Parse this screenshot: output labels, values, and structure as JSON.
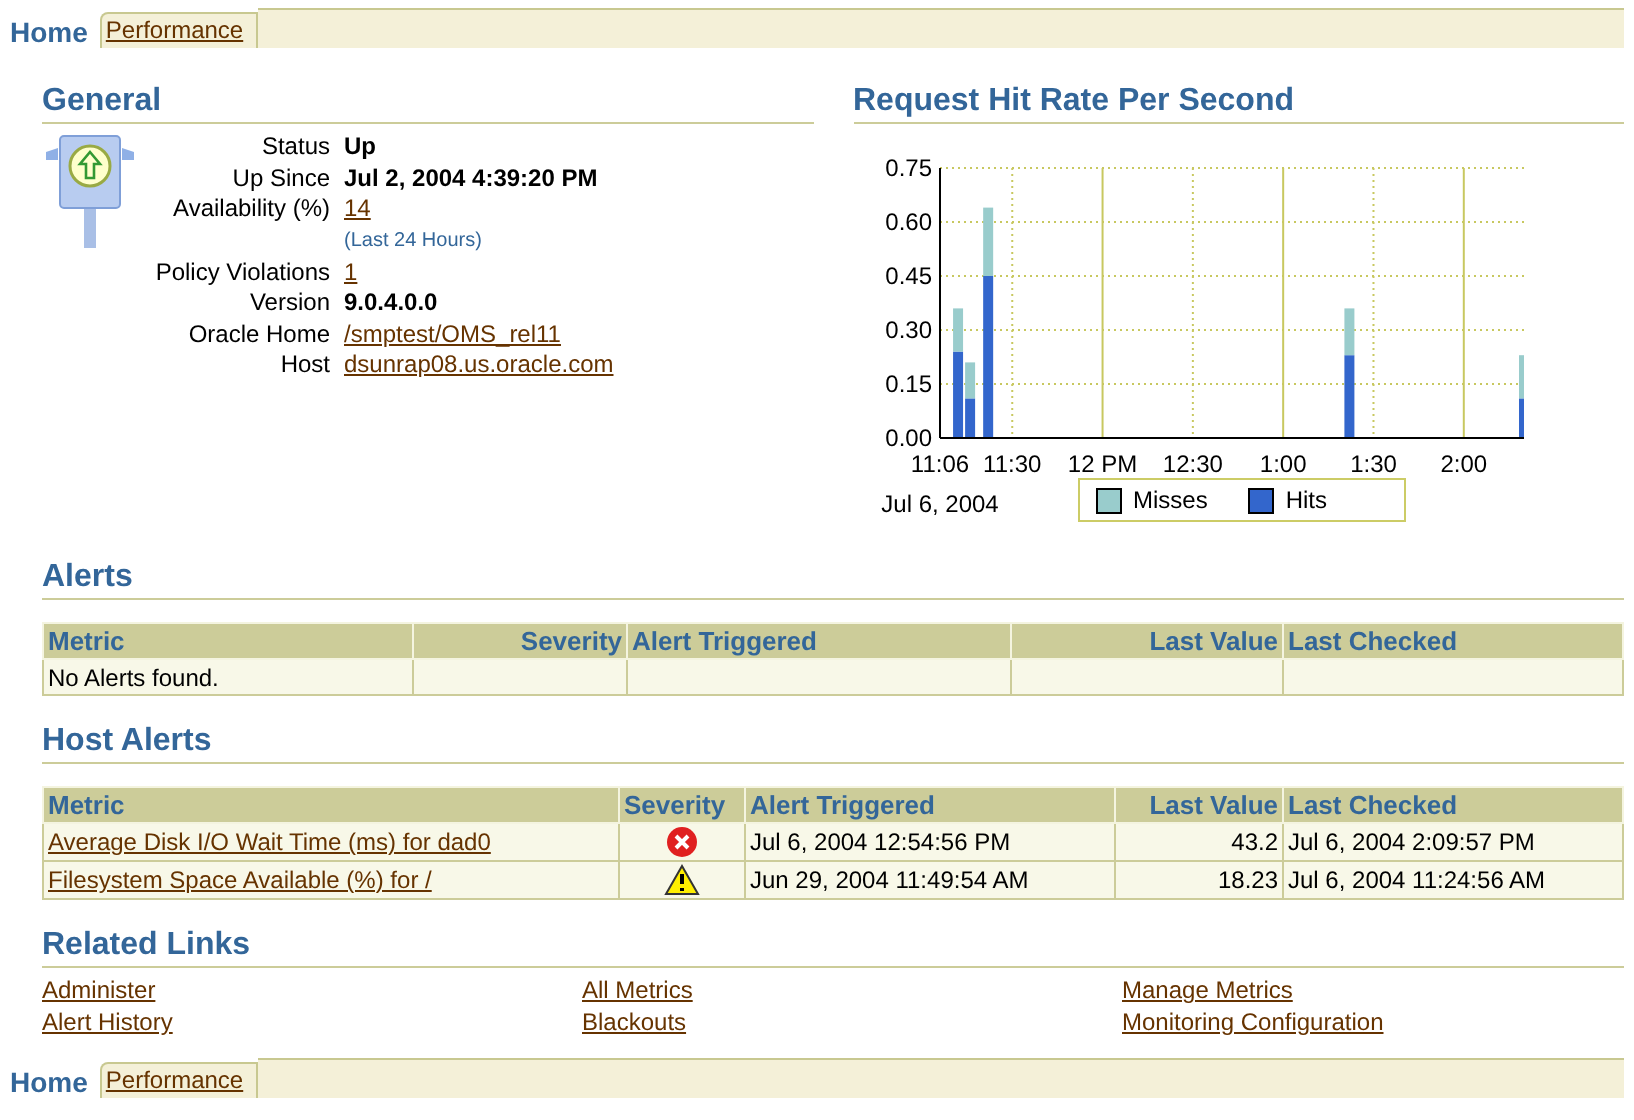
{
  "tabs": [
    {
      "label": "Home",
      "selected": true
    },
    {
      "label": "Performance",
      "selected": false
    }
  ],
  "general": {
    "title": "General",
    "properties": [
      {
        "label": "Status",
        "value": "Up",
        "kind": "text"
      },
      {
        "label": "Up Since",
        "value": "Jul 2, 2004 4:39:20 PM",
        "kind": "text"
      },
      {
        "label": "Availability (%)",
        "value": "14",
        "kind": "link",
        "note": "(Last 24 Hours)"
      },
      {
        "label": "Policy Violations",
        "value": "1",
        "kind": "link"
      },
      {
        "label": "Version",
        "value": "9.0.4.0.0",
        "kind": "text"
      },
      {
        "label": "Oracle Home",
        "value": "/smptest/OMS_rel11",
        "kind": "link"
      },
      {
        "label": "Host",
        "value": "dsunrap08.us.oracle.com",
        "kind": "link"
      }
    ]
  },
  "hit_rate": {
    "title": "Request Hit Rate Per Second",
    "date_label": "Jul 6, 2004",
    "chart_data": {
      "type": "bar",
      "stacked": true,
      "categories": [
        "11:06",
        null,
        null,
        null,
        null,
        null,
        null,
        null,
        null,
        null,
        null,
        null,
        "11:30",
        null,
        null,
        null,
        null,
        null,
        null,
        null,
        null,
        null,
        null,
        null,
        null,
        null,
        null,
        "12 PM",
        null,
        null,
        null,
        null,
        null,
        null,
        null,
        null,
        null,
        null,
        null,
        null,
        null,
        null,
        "12:30",
        null,
        null,
        null,
        null,
        null,
        null,
        null,
        null,
        null,
        null,
        null,
        null,
        null,
        null,
        "1:00",
        null,
        null,
        null,
        null,
        null,
        null,
        null,
        null,
        null,
        null,
        null,
        null,
        null,
        null,
        "1:30",
        null,
        null,
        null,
        null,
        null,
        null,
        null,
        null,
        null,
        null,
        null,
        null,
        null,
        null,
        "2:00",
        null,
        null,
        null,
        null,
        null,
        null,
        null,
        null,
        null,
        null
      ],
      "series": [
        {
          "name": "Misses",
          "color": "#99cccc",
          "values": [
            null,
            null,
            null,
            0.12,
            null,
            0.1,
            null,
            null,
            0.19,
            null,
            null,
            null,
            null,
            null,
            null,
            null,
            null,
            null,
            null,
            null,
            null,
            null,
            null,
            null,
            null,
            null,
            null,
            null,
            null,
            null,
            null,
            null,
            null,
            null,
            null,
            null,
            null,
            null,
            null,
            null,
            null,
            null,
            null,
            null,
            null,
            null,
            null,
            null,
            null,
            null,
            null,
            null,
            null,
            null,
            null,
            null,
            null,
            null,
            null,
            null,
            null,
            null,
            null,
            null,
            null,
            null,
            null,
            null,
            0.13,
            null,
            null,
            null,
            null,
            null,
            null,
            null,
            null,
            null,
            null,
            null,
            null,
            null,
            null,
            null,
            null,
            null,
            null,
            null,
            null,
            null,
            null,
            null,
            null,
            null,
            null,
            null,
            null,
            0.12
          ]
        },
        {
          "name": "Hits",
          "color": "#3366cc",
          "values": [
            null,
            null,
            null,
            0.24,
            null,
            0.11,
            null,
            null,
            0.45,
            null,
            null,
            null,
            null,
            null,
            null,
            null,
            null,
            null,
            null,
            null,
            null,
            null,
            null,
            null,
            null,
            null,
            null,
            null,
            null,
            null,
            null,
            null,
            null,
            null,
            null,
            null,
            null,
            null,
            null,
            null,
            null,
            null,
            null,
            null,
            null,
            null,
            null,
            null,
            null,
            null,
            null,
            null,
            null,
            null,
            null,
            null,
            null,
            null,
            null,
            null,
            null,
            null,
            null,
            null,
            null,
            null,
            null,
            null,
            0.23,
            null,
            null,
            null,
            null,
            null,
            null,
            null,
            null,
            null,
            null,
            null,
            null,
            null,
            null,
            null,
            null,
            null,
            null,
            null,
            null,
            null,
            null,
            null,
            null,
            null,
            null,
            null,
            null,
            0.11
          ]
        }
      ],
      "ylim": [
        0,
        0.75
      ],
      "grid": true,
      "legend": "bottom",
      "yticks": [
        {
          "value": 0,
          "label": "0.00"
        },
        {
          "value": 0.15,
          "label": "0.15"
        },
        {
          "value": 0.3,
          "label": "0.30"
        },
        {
          "value": 0.45,
          "label": "0.45"
        },
        {
          "value": 0.6,
          "label": "0.60"
        },
        {
          "value": 0.75,
          "label": "0.75"
        }
      ]
    }
  },
  "alerts": {
    "title": "Alerts",
    "columns": [
      "Metric",
      "Severity",
      "Alert Triggered",
      "Last Value",
      "Last Checked"
    ],
    "empty_message": "No Alerts found."
  },
  "host_alerts": {
    "title": "Host Alerts",
    "columns": [
      "Metric",
      "Severity",
      "Alert Triggered",
      "Last Value",
      "Last Checked"
    ],
    "rows": [
      {
        "metric": "Average Disk I/O Wait Time (ms) for dad0",
        "kind": "critical",
        "triggered": "Jul 6, 2004 12:54:56 PM",
        "last_value": "43.2",
        "last_checked": "Jul 6, 2004 2:09:57 PM"
      },
      {
        "metric": "Filesystem Space Available (%) for /",
        "kind": "warning",
        "triggered": "Jun 29, 2004 11:49:54 AM",
        "last_value": "18.23",
        "last_checked": "Jul 6, 2004 11:24:56 AM"
      }
    ]
  },
  "related_links": {
    "title": "Related Links",
    "links": [
      "Administer",
      "All Metrics",
      "Manage Metrics",
      "Alert History",
      "Blackouts",
      "Monitoring Configuration"
    ]
  },
  "bottom_tabs": [
    {
      "label": "Home",
      "selected": true
    },
    {
      "label": "Performance",
      "selected": false
    }
  ]
}
